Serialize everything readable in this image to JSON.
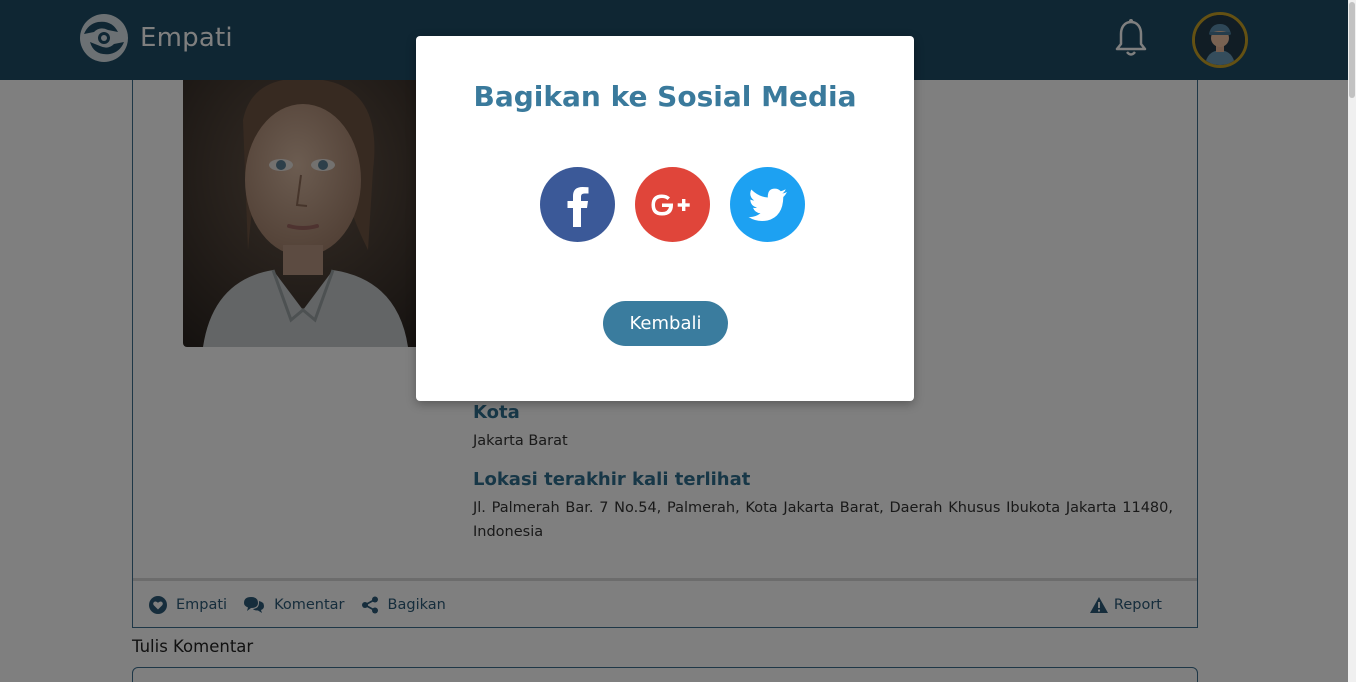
{
  "header": {
    "brand": "Empati",
    "icons": {
      "notifications": "bell-icon",
      "profile": "user-avatar"
    }
  },
  "profile": {
    "fields": [
      {
        "label": "Kota",
        "value": "Jakarta Barat"
      },
      {
        "label": "Lokasi terakhir kali terlihat",
        "value": "Jl. Palmerah Bar. 7 No.54, Palmerah, Kota Jakarta Barat, Daerah Khusus Ibukota Jakarta 11480, Indonesia"
      }
    ]
  },
  "actions": {
    "empati": "Empati",
    "komentar": "Komentar",
    "bagikan": "Bagikan",
    "report": "Report"
  },
  "comment": {
    "label": "Tulis Komentar"
  },
  "modal": {
    "title": "Bagikan ke Sosial Media",
    "share_targets": [
      "facebook-icon",
      "google-plus-icon",
      "twitter-icon"
    ],
    "back_label": "Kembali"
  },
  "colors": {
    "header_bg": "#1f4d66",
    "accent": "#3a7c9e",
    "facebook": "#3b5998",
    "google_plus": "#e0453a",
    "twitter": "#1da1f2",
    "avatar_ring": "#c9a227"
  }
}
